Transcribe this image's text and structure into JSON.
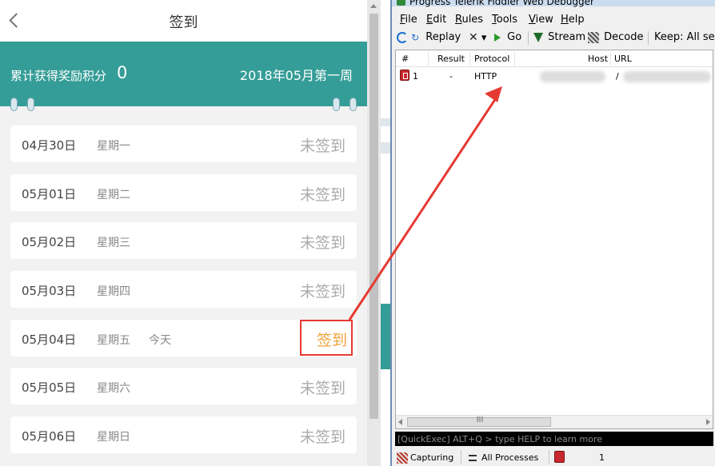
{
  "app": {
    "title": "签到",
    "banner": {
      "points_label": "累计获得奖励积分",
      "points_value": "0",
      "week_label": "2018年05月第一周"
    },
    "days": [
      {
        "date": "04月30日",
        "weekday": "星期一",
        "today": "",
        "status": "未签到",
        "active": false
      },
      {
        "date": "05月01日",
        "weekday": "星期二",
        "today": "",
        "status": "未签到",
        "active": false
      },
      {
        "date": "05月02日",
        "weekday": "星期三",
        "today": "",
        "status": "未签到",
        "active": false
      },
      {
        "date": "05月03日",
        "weekday": "星期四",
        "today": "",
        "status": "未签到",
        "active": false
      },
      {
        "date": "05月04日",
        "weekday": "星期五",
        "today": "今天",
        "status": "签到",
        "active": true
      },
      {
        "date": "05月05日",
        "weekday": "星期六",
        "today": "",
        "status": "未签到",
        "active": false
      },
      {
        "date": "05月06日",
        "weekday": "星期日",
        "today": "",
        "status": "未签到",
        "active": false
      }
    ],
    "colors": {
      "teal": "#359d97",
      "signin_orange": "#f0a23a",
      "annotation_red": "#e53a33"
    }
  },
  "fiddler": {
    "title": "Progress Telerik Fiddler Web Debugger",
    "menu": [
      "File",
      "Edit",
      "Rules",
      "Tools",
      "View",
      "Help"
    ],
    "toolbar": {
      "replay": "Replay",
      "remove": "✕",
      "remove_caret": "▾",
      "go": "Go",
      "stream": "Stream",
      "decode": "Decode",
      "keep": "Keep: All sess"
    },
    "columns": [
      "#",
      "Result",
      "Protocol",
      "Host",
      "URL"
    ],
    "session": {
      "id": "1",
      "result": "-",
      "protocol": "HTTP",
      "url": "/"
    },
    "hscroll_grip": "III",
    "quickexec": "[QuickExec] ALT+Q > type HELP to learn more",
    "status": {
      "capturing": "Capturing",
      "processes": "All Processes",
      "count": "1"
    }
  }
}
